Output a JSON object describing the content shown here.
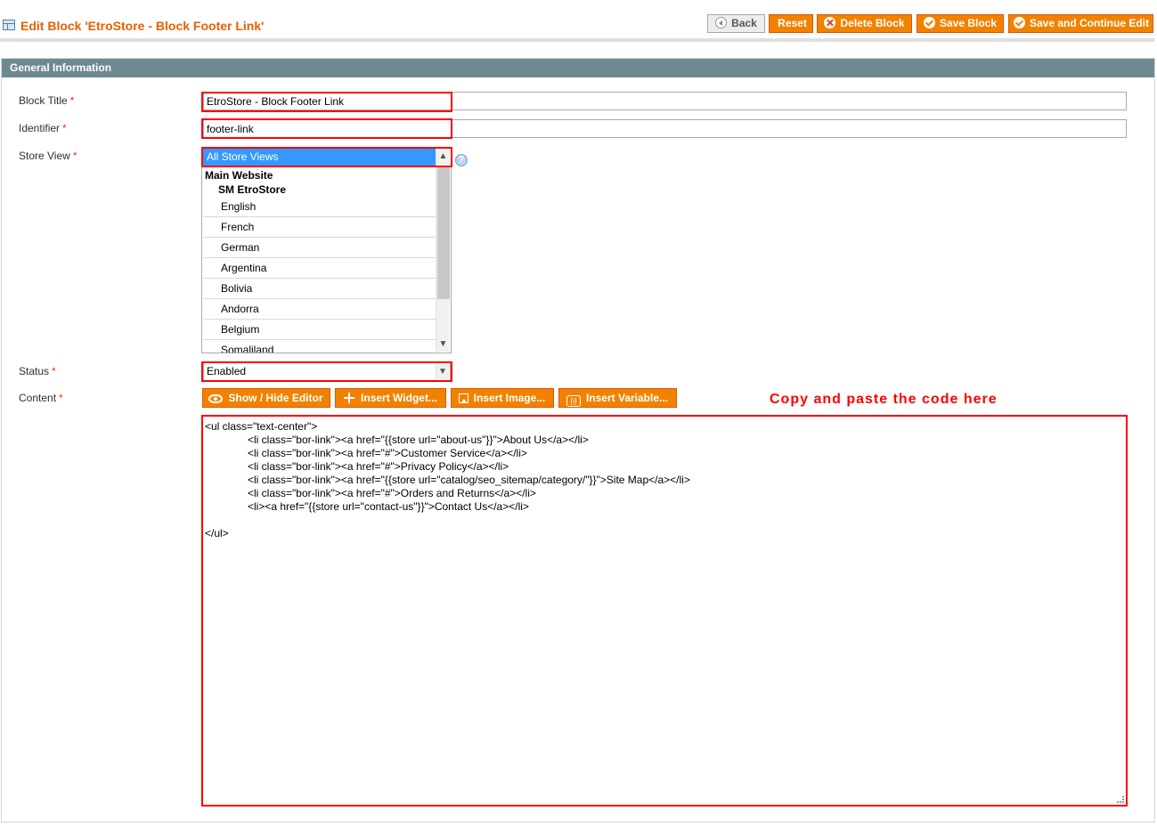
{
  "header": {
    "title": "Edit Block 'EtroStore - Block Footer Link'",
    "buttons": {
      "back": "Back",
      "reset": "Reset",
      "delete": "Delete Block",
      "save": "Save Block",
      "save_continue": "Save and Continue Edit"
    }
  },
  "panel": {
    "title": "General Information"
  },
  "form": {
    "block_title": {
      "label": "Block Title",
      "required": "*",
      "value": "EtroStore - Block Footer Link"
    },
    "identifier": {
      "label": "Identifier",
      "required": "*",
      "value": "footer-link"
    },
    "store_view": {
      "label": "Store View",
      "required": "*",
      "selected": "All Store Views",
      "group": "Main Website",
      "subgroup": "SM EtroStore",
      "options": [
        "English",
        "French",
        "German",
        "Argentina",
        "Bolivia",
        "Andorra",
        "Belgium",
        "Somaliland"
      ],
      "help_icon": "help-icon"
    },
    "status": {
      "label": "Status",
      "required": "*",
      "value": "Enabled"
    },
    "content": {
      "label": "Content",
      "required": "*",
      "buttons": {
        "show_hide": "Show / Hide Editor",
        "insert_widget": "Insert Widget...",
        "insert_image": "Insert Image...",
        "insert_variable": "Insert Variable..."
      },
      "annotation": "Copy and paste the code here",
      "code_lines": [
        "<ul class=\"text-center\">",
        "<li class=\"bor-link\"><a href=\"{{store url=\"about-us\"}}\">About Us</a></li>",
        "<li class=\"bor-link\"><a href=\"#\">Customer Service</a></li>",
        "<li class=\"bor-link\"><a href=\"#\">Privacy Policy</a></li>",
        "<li class=\"bor-link\"><a href=\"{{store url=\"catalog/seo_sitemap/category/\"}}\">Site Map</a></li>",
        "<li class=\"bor-link\"><a href=\"#\">Orders and Returns</a></li>",
        "<li><a href=\"{{store url=\"contact-us\"}}\">Contact Us</a></li>",
        "",
        "</ul>"
      ]
    }
  },
  "colors": {
    "accent": "#f18200",
    "title": "#eb5e00",
    "panel_header": "#6f8992",
    "highlight": "#ff0000",
    "selection": "#3399ff"
  }
}
